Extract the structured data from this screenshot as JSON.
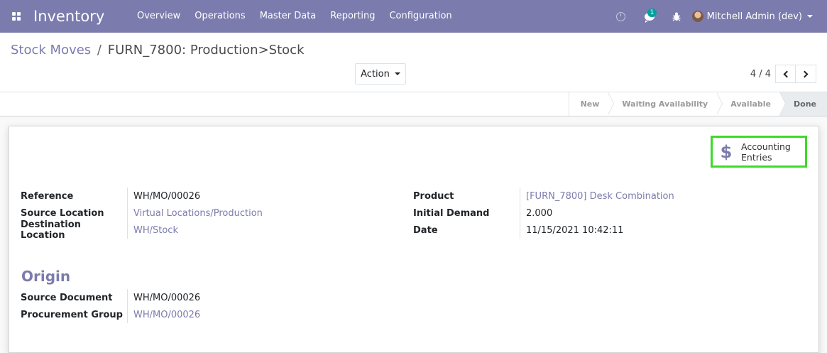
{
  "navbar": {
    "app_name": "Inventory",
    "menu": [
      "Overview",
      "Operations",
      "Master Data",
      "Reporting",
      "Configuration"
    ],
    "chat_badge": "1",
    "user_name": "Mitchell Admin (dev)",
    "color": "#7c7bad"
  },
  "breadcrumb": {
    "parent": "Stock Moves",
    "separator": "/",
    "current": "FURN_7800: Production>Stock"
  },
  "toolbar": {
    "action_label": "Action"
  },
  "pager": {
    "value": "4 / 4"
  },
  "statusbar": {
    "steps": [
      "New",
      "Waiting Availability",
      "Available",
      "Done"
    ],
    "current": "Done"
  },
  "smart_button": {
    "icon": "dollar-icon",
    "glyph": "$",
    "label_line1": "Accounting",
    "label_line2": "Entries",
    "highlight_color": "#3cdb27"
  },
  "form": {
    "left": [
      {
        "label": "Reference",
        "value": "WH/MO/00026",
        "link": false
      },
      {
        "label": "Source Location",
        "value": "Virtual Locations/Production",
        "link": true
      },
      {
        "label": "Destination Location",
        "value": "WH/Stock",
        "link": true
      }
    ],
    "right": [
      {
        "label": "Product",
        "value": "[FURN_7800] Desk Combination",
        "link": true
      },
      {
        "label": "Initial Demand",
        "value": "2.000",
        "link": false
      },
      {
        "label": "Date",
        "value": "11/15/2021 10:42:11",
        "link": false
      }
    ],
    "origin_title": "Origin",
    "origin": [
      {
        "label": "Source Document",
        "value": "WH/MO/00026",
        "link": false
      },
      {
        "label": "Procurement Group",
        "value": "WH/MO/00026",
        "link": true
      }
    ]
  }
}
